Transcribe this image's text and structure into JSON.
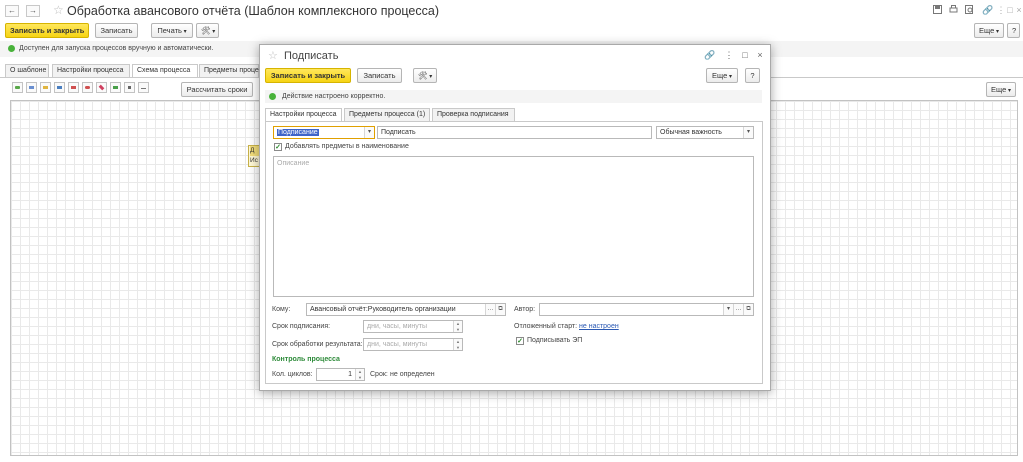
{
  "window": {
    "title": "Обработка авансового отчёта (Шаблон комплексного процесса)",
    "nav_back": "←",
    "nav_forward": "→",
    "star": "☆",
    "title_icons": [
      "save-icon",
      "print-icon",
      "preview-icon",
      "link-icon",
      "more-icon",
      "maximize-icon",
      "close-icon"
    ]
  },
  "toolbar": {
    "save_close": "Записать и закрыть",
    "save": "Записать",
    "print": "Печать",
    "tools": "🛠",
    "more": "Еще",
    "help": "?"
  },
  "info_bar": {
    "text": "Доступен для запуска процессов вручную и автоматически."
  },
  "main_tabs": [
    "О шаблоне",
    "Настройки процесса",
    "Схема процесса",
    "Предметы процесса"
  ],
  "schema_toolbar": {
    "calc_button": "Рассчитать сроки",
    "more": "Еще"
  },
  "canvas_node": {
    "line1": "Д",
    "line2": "Ис"
  },
  "dialog": {
    "title": "Подписать",
    "star": "☆",
    "save_close": "Записать и закрыть",
    "save": "Записать",
    "tools": "🛠",
    "more": "Еще",
    "help": "?",
    "link_icon": "🔗",
    "menu_icon": "⋮",
    "max_icon": "□",
    "close_icon": "×",
    "info_text": "Действие настроено корректно.",
    "tabs": [
      "Настройки процесса",
      "Предметы процесса (1)",
      "Проверка подписания"
    ],
    "settings": {
      "type_value": "Подписание",
      "name_value": "Подписать",
      "importance_value": "Обычная важность",
      "add_subjects_label": "Добавлять предметы в наименование",
      "add_subjects_checked": true,
      "description_placeholder": "Описание",
      "to_label": "Кому:",
      "to_value": "Авансовый отчёт:Руководитель организации",
      "author_label": "Автор:",
      "author_value": "",
      "deadline_label": "Срок подписания:",
      "deadline_placeholder": "дни, часы, минуты",
      "result_deadline_label": "Срок обработки результата:",
      "result_deadline_placeholder": "дни, часы, минуты",
      "deferred_label": "Отложенный старт:",
      "deferred_link": "не настроен",
      "sign_ep_label": "Подписывать ЭП",
      "sign_ep_checked": true,
      "control_heading": "Контроль процесса",
      "cycles_label": "Кол. циклов:",
      "cycles_value": "1",
      "term_label": "Срок:",
      "term_value": "не определен"
    }
  },
  "colors": {
    "accent_yellow": "#f6d414",
    "ok_green": "#48b23a",
    "heading_green": "#2e8b3a",
    "link_blue": "#2b59b3"
  }
}
